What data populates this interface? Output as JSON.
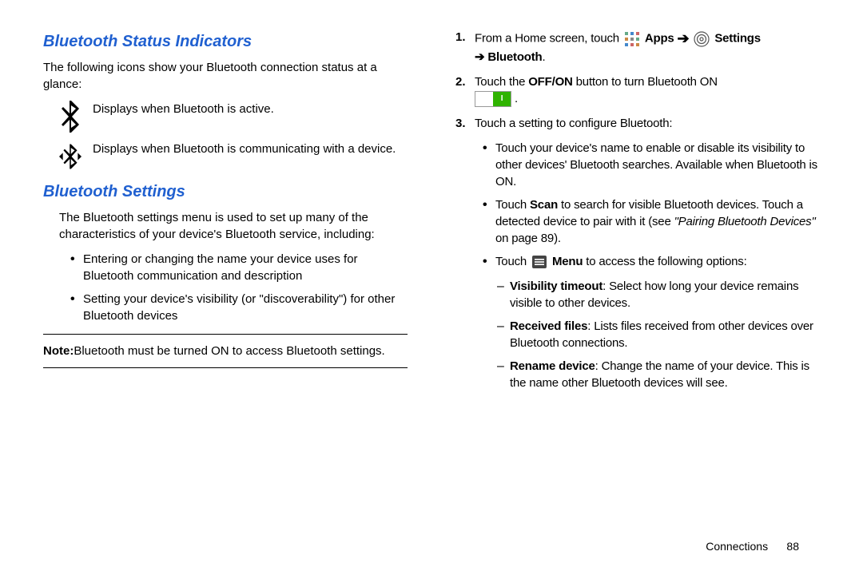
{
  "left": {
    "heading1": "Bluetooth Status Indicators",
    "intro1": "The following icons show your Bluetooth connection status at a glance:",
    "icon1_desc": "Displays when Bluetooth is active.",
    "icon2_desc": "Displays when Bluetooth is communicating with a device.",
    "heading2": "Bluetooth Settings",
    "intro2": "The Bluetooth settings menu is used to set up many of the characteristics of your device's Bluetooth service, including:",
    "bullets": {
      "b1": "Entering or changing the name your device uses for Bluetooth communication and description",
      "b2": "Setting your device's visibility (or \"discoverability\") for other Bluetooth devices"
    },
    "note_label": "Note:",
    "note_text": "Bluetooth must be turned ON to access Bluetooth settings."
  },
  "right": {
    "steps": {
      "s1_a": "From a Home screen, touch ",
      "s1_apps": " Apps ",
      "s1_settings": " Settings",
      "s1_arrow": "➔",
      "s1_bt": "➔ Bluetooth",
      "s1_period": ".",
      "s2_a": "Touch the ",
      "s2_offon": "OFF/ON",
      "s2_b": " button to turn Bluetooth ON ",
      "s2_end": ".",
      "s3": "Touch a setting to configure Bluetooth:"
    },
    "sub": {
      "a": "Touch your device's name to enable or disable its visibility to other devices' Bluetooth searches. Available when Bluetooth is ON.",
      "b_pre": "Touch ",
      "b_scan": "Scan",
      "b_mid": " to search for visible Bluetooth devices. Touch a detected device to pair with it (see ",
      "b_ref": "\"Pairing Bluetooth Devices\"",
      "b_post": " on page 89).",
      "c_pre": "Touch ",
      "c_menu": " Menu",
      "c_post": " to access the following options:"
    },
    "menu": {
      "m1_label": "Visibility timeout",
      "m1_text": ": Select how long your device remains visible to other devices.",
      "m2_label": "Received files",
      "m2_text": ": Lists files received from other devices over Bluetooth connections.",
      "m3_label": "Rename device",
      "m3_text": ": Change the name of your device. This is the name other Bluetooth devices will see."
    },
    "toggle_label": "I"
  },
  "footer": {
    "section": "Connections",
    "page": "88"
  },
  "icons": {
    "bt_active": "bluetooth-icon",
    "bt_comm": "bluetooth-communicating-icon",
    "apps": "apps-grid-icon",
    "settings": "settings-gear-icon",
    "menu": "menu-bars-icon"
  }
}
